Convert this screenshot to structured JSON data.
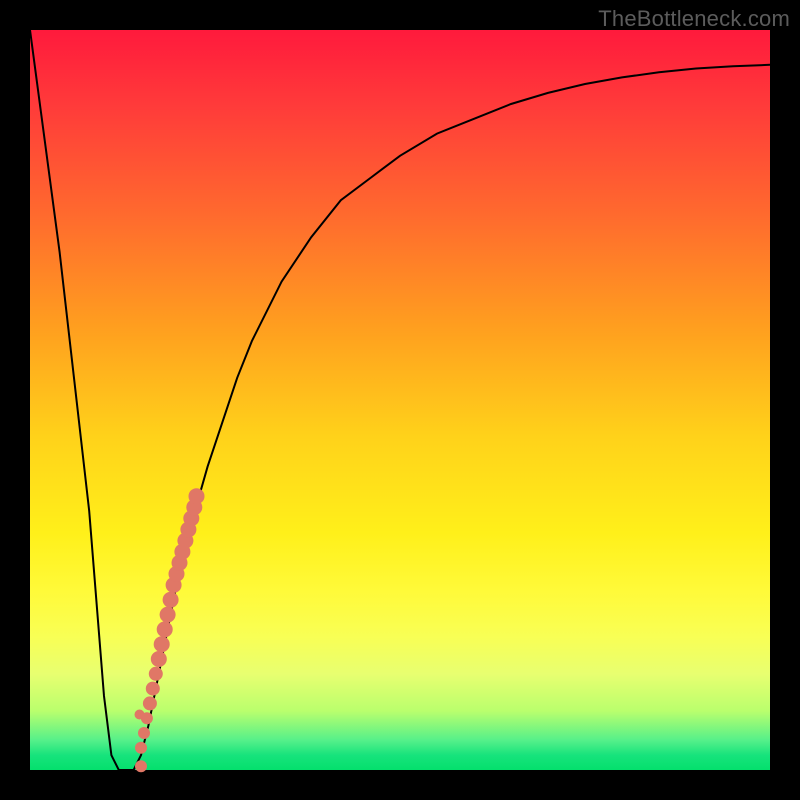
{
  "watermark": "TheBottleneck.com",
  "colors": {
    "frame": "#000000",
    "curve": "#000000",
    "points": "#e07766"
  },
  "chart_data": {
    "type": "line",
    "title": "",
    "xlabel": "",
    "ylabel": "",
    "xlim": [
      0,
      100
    ],
    "ylim": [
      0,
      100
    ],
    "grid": false,
    "series": [
      {
        "name": "bottleneck-curve",
        "x": [
          0,
          4,
          8,
          10,
          11,
          12,
          13,
          14,
          15,
          16,
          18,
          20,
          22,
          24,
          26,
          28,
          30,
          34,
          38,
          42,
          46,
          50,
          55,
          60,
          65,
          70,
          75,
          80,
          85,
          90,
          95,
          100
        ],
        "y": [
          100,
          70,
          35,
          10,
          2,
          0,
          0,
          0,
          2,
          6,
          16,
          26,
          34,
          41,
          47,
          53,
          58,
          66,
          72,
          77,
          80,
          83,
          86,
          88,
          90,
          91.5,
          92.7,
          93.6,
          94.3,
          94.8,
          95.1,
          95.3
        ]
      }
    ],
    "points": {
      "name": "highlight-cluster",
      "x": [
        15.0,
        15.4,
        15.8,
        16.2,
        16.6,
        17.0,
        17.4,
        17.8,
        18.2,
        18.6,
        19.0,
        19.4,
        19.8,
        20.2,
        20.6,
        21.0,
        21.4,
        21.8,
        22.2,
        22.5,
        15.0,
        14.8
      ],
      "y": [
        3.0,
        5.0,
        7.0,
        9.0,
        11.0,
        13.0,
        15.0,
        17.0,
        19.0,
        21.0,
        23.0,
        25.0,
        26.5,
        28.0,
        29.5,
        31.0,
        32.5,
        34.0,
        35.5,
        37.0,
        0.5,
        7.5
      ],
      "r": [
        6,
        6,
        6,
        7,
        7,
        7,
        8,
        8,
        8,
        8,
        8,
        8,
        8,
        8,
        8,
        8,
        8,
        8,
        8,
        8,
        6,
        5
      ]
    }
  }
}
